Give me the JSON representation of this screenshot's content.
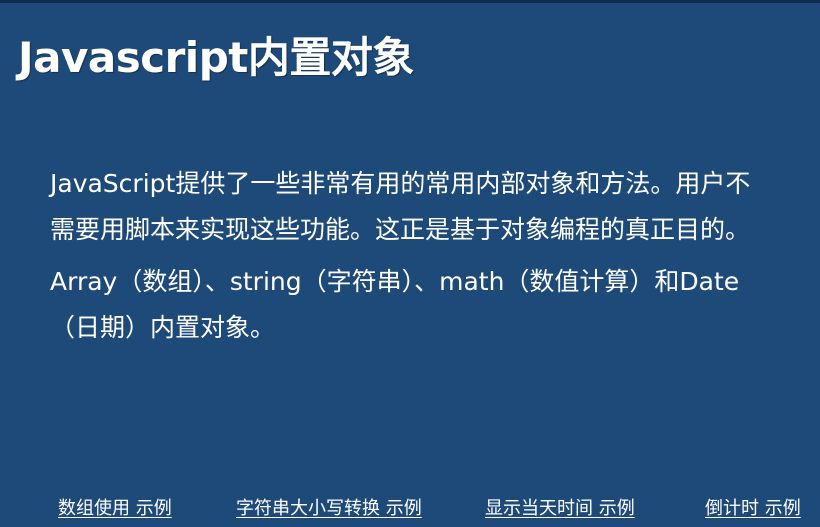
{
  "slide": {
    "title": "Javascript内置对象",
    "paragraphs": [
      "JavaScript提供了一些非常有用的常用内部对象和方法。用户不需要用脚本来实现这些功能。这正是基于对象编程的真正目的。",
      "Array（数组）、string（字符串）、math（数值计算）和Date（日期）内置对象。"
    ]
  },
  "links": [
    "数组使用 示例",
    "字符串大小写转换 示例",
    "显示当天时间 示例",
    "倒计时 示例"
  ],
  "colors": {
    "background": "#1e4a79",
    "text": "#ffffff"
  }
}
